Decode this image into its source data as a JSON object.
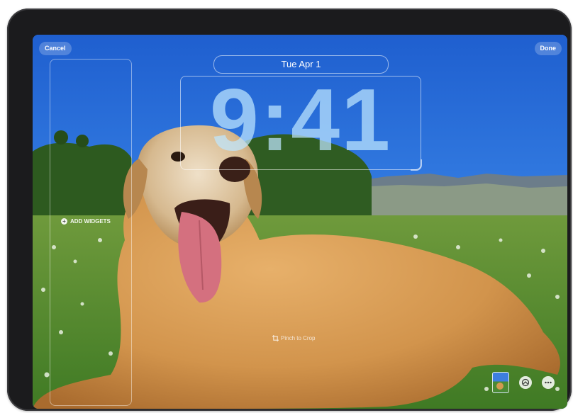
{
  "header": {
    "cancel_label": "Cancel",
    "done_label": "Done"
  },
  "lock_screen": {
    "date": "Tue Apr 1",
    "time": "9:41"
  },
  "widgets": {
    "add_label": "ADD WIDGETS"
  },
  "hint": {
    "pinch_label": "Pinch to Crop"
  },
  "controls": {
    "photo_thumb_icon": "photo-thumbnail",
    "effect_icon": "depth-effect-icon",
    "more_icon": "ellipsis-icon"
  },
  "colors": {
    "sky": "#2f6fd9",
    "grass": "#4f8f2f",
    "dog": "#d2944c",
    "time_tint": "#bee6ff"
  }
}
